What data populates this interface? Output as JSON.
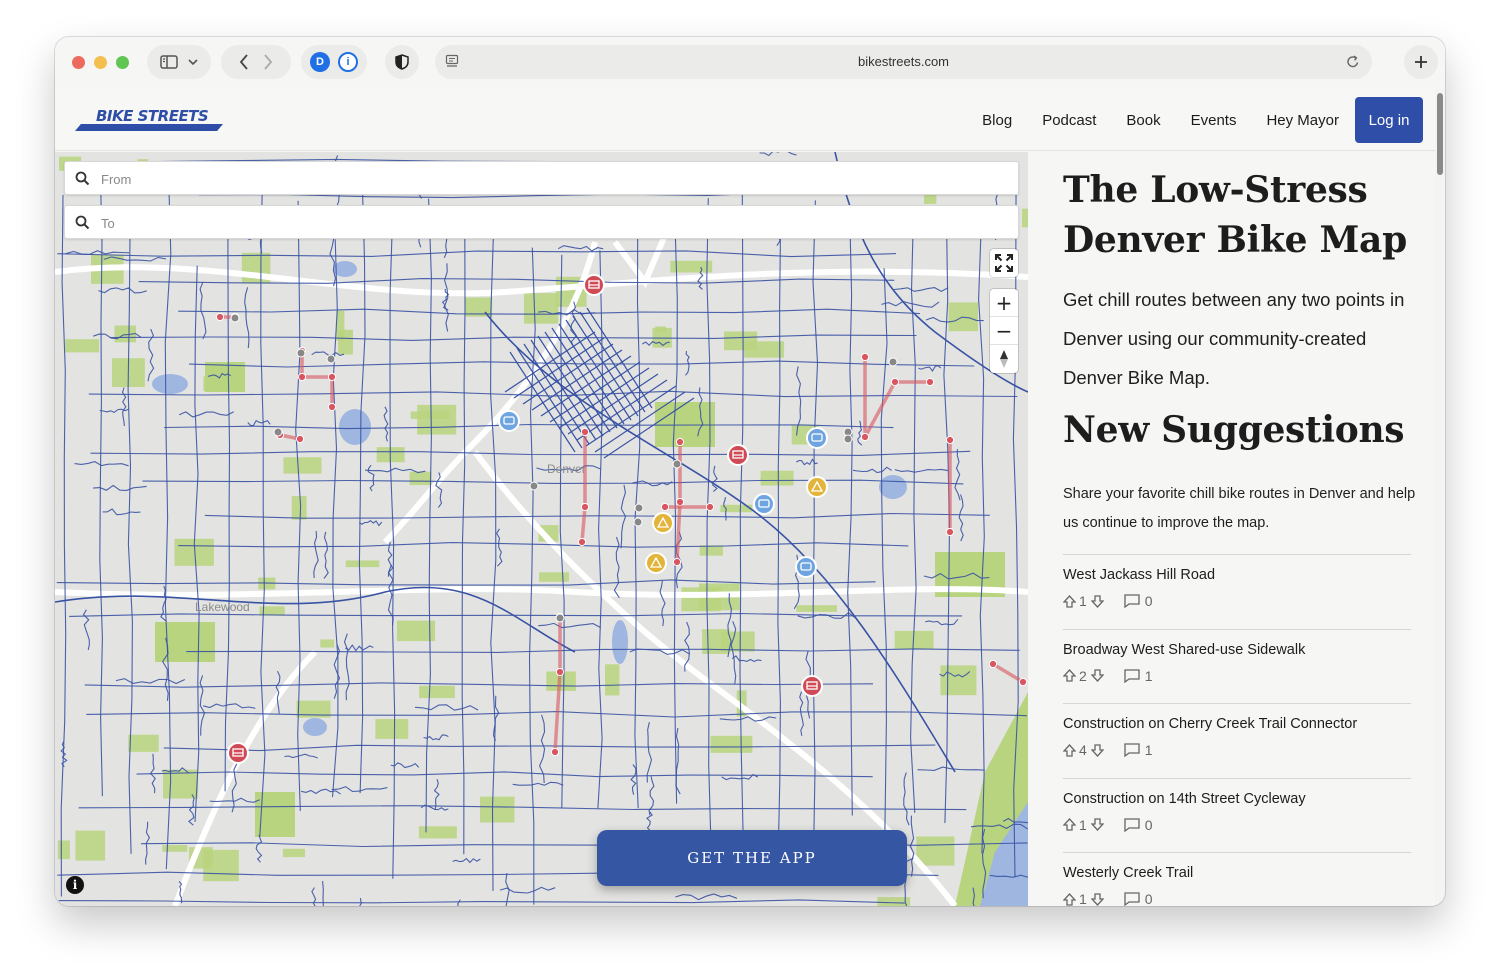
{
  "browser": {
    "url": "bikestreets.com",
    "ext_d_letter": "D",
    "ext_1p_letter": "i"
  },
  "site": {
    "logo_text": "BIKE STREETS",
    "nav": [
      "Blog",
      "Podcast",
      "Book",
      "Events",
      "Hey Mayor"
    ],
    "login_label": "Log in"
  },
  "map": {
    "from_placeholder": "From",
    "to_placeholder": "To",
    "zoom_in": "+",
    "zoom_out": "−",
    "info": "i",
    "get_app_label": "GET THE APP",
    "labels": {
      "denver": "Denver",
      "lakewood": "Lakewood"
    },
    "colors": {
      "road_blue": "#3852a4",
      "route_red": "#d9555f",
      "park_green": "#b8d47e",
      "water": "#9fb6e0",
      "highway": "#ffffff"
    }
  },
  "panel": {
    "title": "The Low-Stress Denver Bike Map",
    "description": "Get chill routes between any two points in Denver using our community-created Denver Bike Map.",
    "subtitle": "New Suggestions",
    "share_text": "Share your favorite chill bike routes in Denver and help us continue to improve the map.",
    "suggestions": [
      {
        "title": "West Jackass Hill Road",
        "votes": "1",
        "comments": "0"
      },
      {
        "title": "Broadway West Shared-use Sidewalk",
        "votes": "2",
        "comments": "1"
      },
      {
        "title": "Construction on Cherry Creek Trail Connector",
        "votes": "4",
        "comments": "1"
      },
      {
        "title": "Construction on 14th Street Cycleway",
        "votes": "1",
        "comments": "0"
      },
      {
        "title": "Westerly Creek Trail",
        "votes": "1",
        "comments": "0"
      }
    ]
  }
}
